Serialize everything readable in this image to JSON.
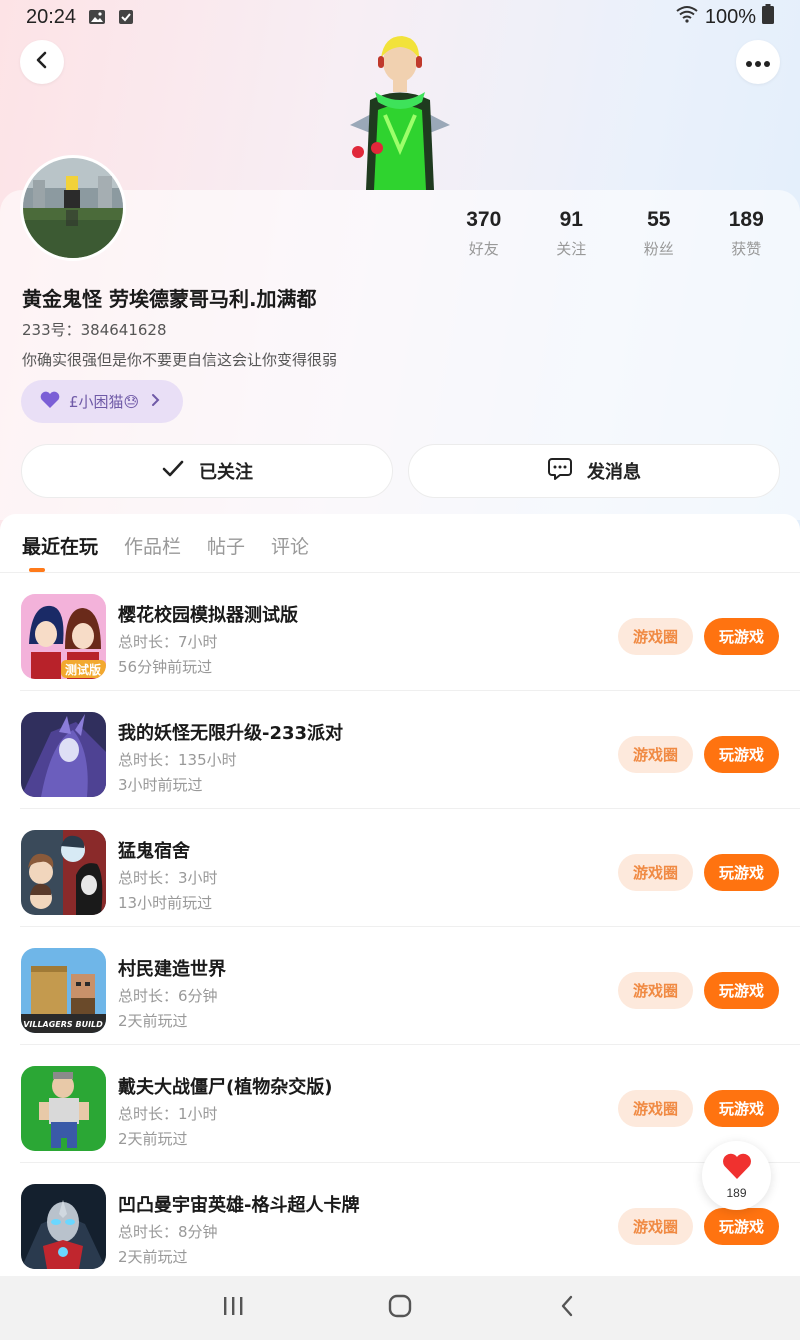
{
  "status_bar": {
    "time": "20:24",
    "battery": "100%"
  },
  "profile": {
    "nickname": "黄金鬼怪 劳埃德蒙哥马利.加满都",
    "uid": "233号：384641628",
    "bio": "你确实很强但是你不要更自信这会让你变得很弱",
    "tag": "£小困猫😓",
    "stats": [
      {
        "value": "370",
        "label": "好友"
      },
      {
        "value": "91",
        "label": "关注"
      },
      {
        "value": "55",
        "label": "粉丝"
      },
      {
        "value": "189",
        "label": "获赞"
      }
    ]
  },
  "actions": {
    "follow_label": "已关注",
    "message_label": "发消息"
  },
  "tabs": [
    {
      "label": "最近在玩",
      "active": true
    },
    {
      "label": "作品栏",
      "active": false
    },
    {
      "label": "帖子",
      "active": false
    },
    {
      "label": "评论",
      "active": false
    }
  ],
  "games": [
    {
      "name": "樱花校园模拟器测试版",
      "duration": "总时长：7小时",
      "last_played": "56分钟前玩过",
      "icon": "sakura-school-icon",
      "icon_text": "测试版"
    },
    {
      "name": "我的妖怪无限升级-233派对",
      "duration": "总时长：135小时",
      "last_played": "3小时前玩过",
      "icon": "monster-upgrade-icon",
      "icon_text": ""
    },
    {
      "name": "猛鬼宿舍",
      "duration": "总时长：3小时",
      "last_played": "13小时前玩过",
      "icon": "ghost-dorm-icon",
      "icon_text": ""
    },
    {
      "name": "村民建造世界",
      "duration": "总时长：6分钟",
      "last_played": "2天前玩过",
      "icon": "villagers-build-icon",
      "icon_text": "VILLAGERS BUILD"
    },
    {
      "name": "戴夫大战僵尸(植物杂交版)",
      "duration": "总时长：1小时",
      "last_played": "2天前玩过",
      "icon": "dave-zombies-icon",
      "icon_text": ""
    },
    {
      "name": "凹凸曼宇宙英雄-格斗超人卡牌",
      "duration": "总时长：8分钟",
      "last_played": "2天前玩过",
      "icon": "ultraman-hero-icon",
      "icon_text": ""
    }
  ],
  "game_buttons": {
    "circle_label": "游戏圈",
    "play_label": "玩游戏"
  },
  "like_fab": {
    "count": "189"
  },
  "colors": {
    "accent": "#ff7310",
    "accent_light": "#fde9dc",
    "tag_bg": "#e9dff6",
    "tag_text": "#6f5aa7"
  }
}
